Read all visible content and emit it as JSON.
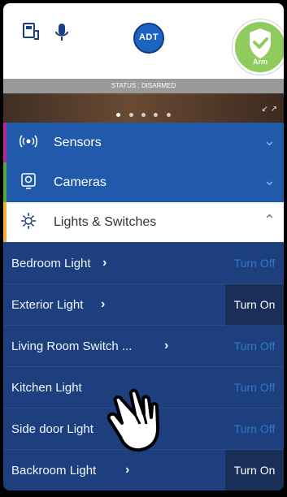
{
  "header": {
    "brand": "ADT",
    "arm_button_label": "Arm"
  },
  "status": {
    "text": "STATUS : DISARMED"
  },
  "hero": {
    "dots": 5,
    "active_dot": 1,
    "expand_label": "↙ ↗"
  },
  "categories": [
    {
      "label": "Sensors",
      "accent": "#b12a93"
    },
    {
      "label": "Cameras",
      "accent": "#57a83e"
    },
    {
      "label": "Lights & Switches",
      "accent": "#f3b13c"
    }
  ],
  "devices": [
    {
      "name": "Bedroom Light",
      "action": "Turn Off",
      "state": "off"
    },
    {
      "name": "Exterior Light",
      "action": "Turn On",
      "state": "on"
    },
    {
      "name": "Living Room Switch ...",
      "action": "Turn Off",
      "state": "off"
    },
    {
      "name": "Kitchen Light",
      "action": "Turn Off",
      "state": "off"
    },
    {
      "name": "Side door Light",
      "action": "Turn Off",
      "state": "off"
    },
    {
      "name": "Backroom Light",
      "action": "Turn On",
      "state": "on"
    }
  ]
}
